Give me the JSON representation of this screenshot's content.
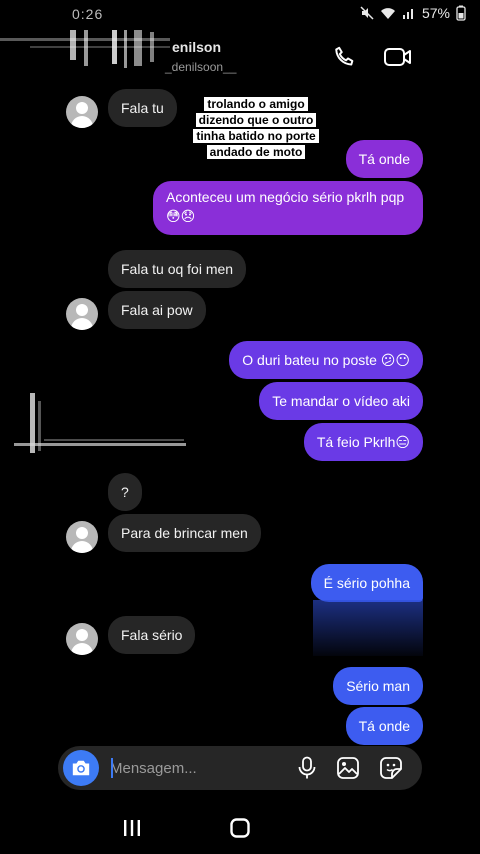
{
  "status_bar": {
    "time": "0:26",
    "battery": "57%"
  },
  "header": {
    "name": "enilson",
    "handle": "_denilsoon__"
  },
  "overlay_caption": [
    "trolando o amigo",
    "dizendo que o outro",
    "tinha batido no porte",
    "andado de moto"
  ],
  "messages": [
    {
      "dir": "recv",
      "text": "Fala tu"
    },
    {
      "dir": "sent",
      "text": "Tá onde"
    },
    {
      "dir": "sent",
      "text": "Aconteceu um negócio sério pkrlh pqp",
      "emoji": "😳😞"
    },
    {
      "dir": "recv",
      "text": "Fala tu oq foi men"
    },
    {
      "dir": "recv",
      "text": "Fala ai pow"
    },
    {
      "dir": "sent",
      "text": "O duri bateu no poste 😕😶"
    },
    {
      "dir": "sent",
      "text": "Te mandar o vídeo aki"
    },
    {
      "dir": "sent",
      "text": "Tá feio Pkrlh😑"
    },
    {
      "dir": "recv",
      "text": "?"
    },
    {
      "dir": "recv",
      "text": "Para de brincar men"
    },
    {
      "dir": "sent",
      "text": "É sério pohha"
    },
    {
      "dir": "recv",
      "text": "Fala sério"
    },
    {
      "dir": "sent",
      "text": "Sério man"
    },
    {
      "dir": "sent",
      "text": "Tá onde"
    }
  ],
  "composer": {
    "placeholder": "Mensagem..."
  },
  "icons": {
    "header": [
      "phone-icon",
      "video-camera-icon"
    ],
    "composer": [
      "camera-icon",
      "microphone-icon",
      "gallery-icon",
      "sticker-icon"
    ],
    "nav": [
      "recent-apps-icon",
      "home-icon"
    ]
  },
  "colors": {
    "background": "#000000",
    "received_bubble": "#262626",
    "sent_purple": "#8a2fd8",
    "sent_violet": "#6a3ae6",
    "sent_blue": "#3d5cf0",
    "accent": "#3d7bf5"
  }
}
